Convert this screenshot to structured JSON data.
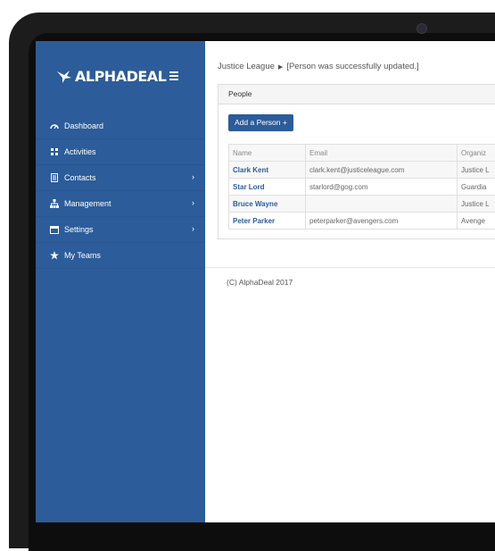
{
  "app": {
    "logo_text": "ALPHADEAL",
    "accent_color": "#2c5c9a"
  },
  "sidebar": {
    "items": [
      {
        "label": "Dashboard",
        "icon": "dashboard-icon",
        "has_submenu": false
      },
      {
        "label": "Activities",
        "icon": "grid-icon",
        "has_submenu": false
      },
      {
        "label": "Contacts",
        "icon": "contacts-icon",
        "has_submenu": true
      },
      {
        "label": "Management",
        "icon": "sitemap-icon",
        "has_submenu": true
      },
      {
        "label": "Settings",
        "icon": "window-icon",
        "has_submenu": true
      },
      {
        "label": "My Teams",
        "icon": "star-icon",
        "has_submenu": false
      }
    ]
  },
  "breadcrumb": {
    "team": "Justice League",
    "message": "[Person was successfully updated.]"
  },
  "panel": {
    "title": "People",
    "add_button": "Add a Person +",
    "columns": [
      "Name",
      "Email",
      "Organiz"
    ],
    "rows": [
      {
        "name": "Clark Kent",
        "email": "clark.kent@justiceleague.com",
        "org": "Justice L"
      },
      {
        "name": "Star Lord",
        "email": "starlord@gog.com",
        "org": "Guardia"
      },
      {
        "name": "Bruce Wayne",
        "email": "",
        "org": "Justice L"
      },
      {
        "name": "Peter Parker",
        "email": "peterparker@avengers.com",
        "org": "Avenge"
      }
    ]
  },
  "footer": {
    "text": "(C) AlphaDeal 2017"
  }
}
